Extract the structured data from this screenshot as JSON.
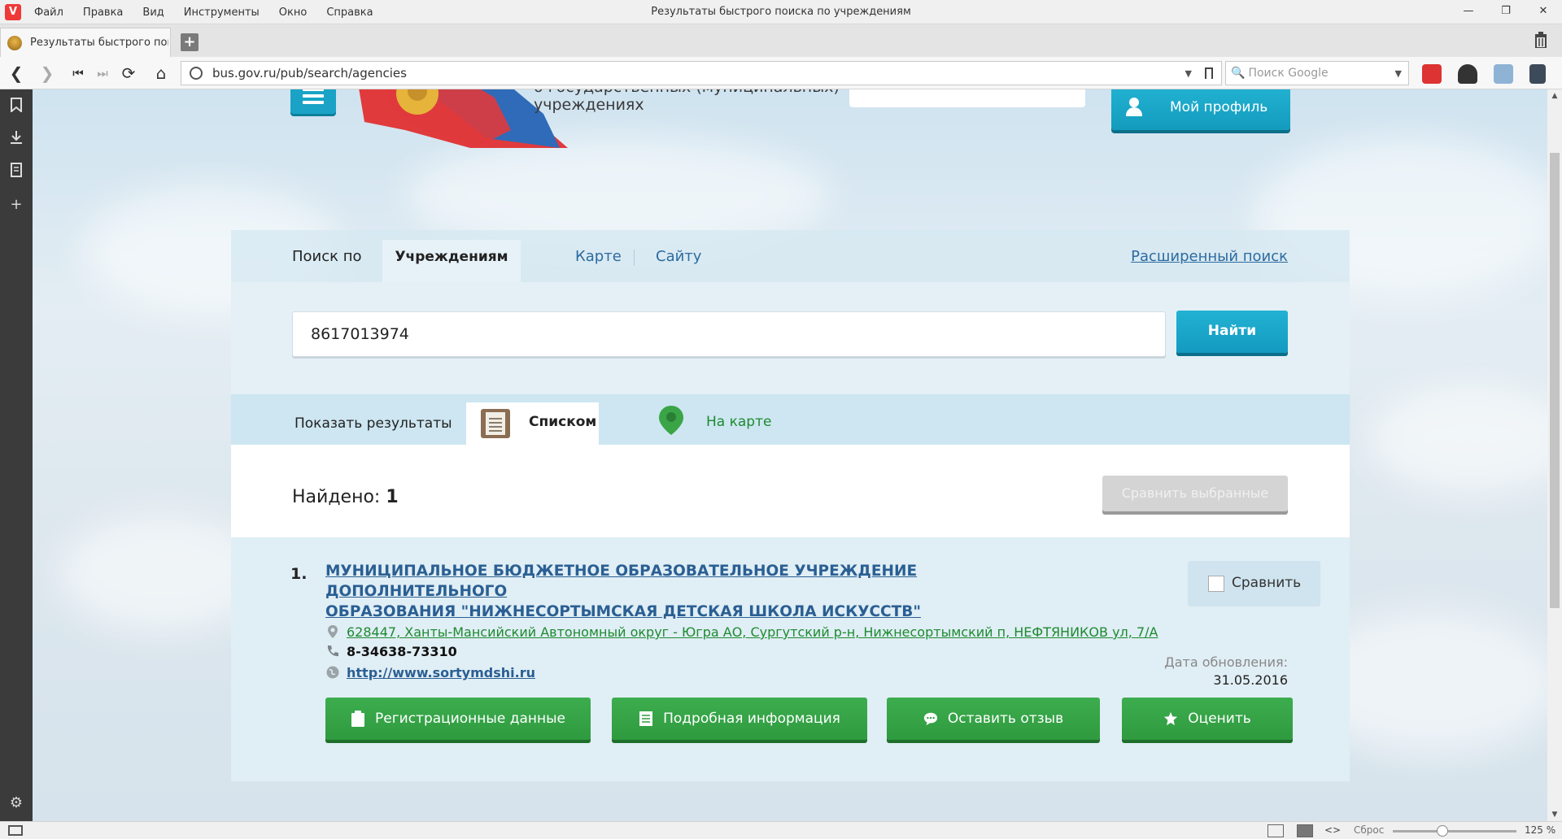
{
  "browser": {
    "menu": [
      "Файл",
      "Правка",
      "Вид",
      "Инструменты",
      "Окно",
      "Справка"
    ],
    "window_title": "Результаты быстрого поиска по учреждениям",
    "tab_title": "Результаты быстрого поис",
    "url": "bus.gov.ru/pub/search/agencies",
    "search_placeholder": "Поиск Google",
    "status": {
      "reset_label": "Сброс",
      "zoom": "125 %"
    }
  },
  "page": {
    "header": {
      "title_line1": "о государственных (муниципальных)",
      "title_line2": "учреждениях",
      "profile_label": "Мой профиль"
    },
    "search_tabs": {
      "label": "Поиск по",
      "active": "Учреждениям",
      "items": [
        "Карте",
        "Сайту"
      ],
      "advanced": "Расширенный поиск"
    },
    "search": {
      "value": "8617013974",
      "button": "Найти"
    },
    "results_view": {
      "label": "Показать результаты",
      "list": "Списком",
      "map": "На карте"
    },
    "found": {
      "label": "Найдено:",
      "count": "1",
      "compare_selected": "Сравнить выбранные"
    },
    "result": {
      "number": "1.",
      "title_line1": "МУНИЦИПАЛЬНОЕ БЮДЖЕТНОЕ ОБРАЗОВАТЕЛЬНОЕ УЧРЕЖДЕНИЕ ДОПОЛНИТЕЛЬНОГО",
      "title_line2": "ОБРАЗОВАНИЯ \"НИЖНЕСОРТЫМСКАЯ ДЕТСКАЯ ШКОЛА ИСКУССТВ\"",
      "address": "628447, Ханты-Мансийский Автономный округ - Югра АО, Сургутский р-н, Нижнесортымский п, НЕФТЯНИКОВ ул, 7/А",
      "phone": "8-34638-73310",
      "website": "http://www.sortymdshi.ru",
      "compare": "Сравнить",
      "updated_label": "Дата обновления:",
      "updated_date": "31.05.2016",
      "actions": {
        "registration": "Регистрационные данные",
        "details": "Подробная информация",
        "review": "Оставить отзыв",
        "rate": "Оценить"
      }
    }
  },
  "colors": {
    "accent_blue": "#1aa3c6",
    "action_green": "#2f9a3f",
    "link_blue": "#2a5f93",
    "address_green": "#1d8a2f"
  },
  "icons": [
    "vivaldi-logo-icon",
    "back-icon",
    "forward-icon",
    "home-icon",
    "reload-icon",
    "bookmark-icon",
    "download-icon",
    "notes-icon",
    "settings-icon",
    "user-icon",
    "list-icon",
    "map-pin-icon",
    "location-icon",
    "phone-icon",
    "globe-icon",
    "clipboard-icon",
    "document-icon",
    "comment-icon",
    "star-icon",
    "trash-icon"
  ]
}
